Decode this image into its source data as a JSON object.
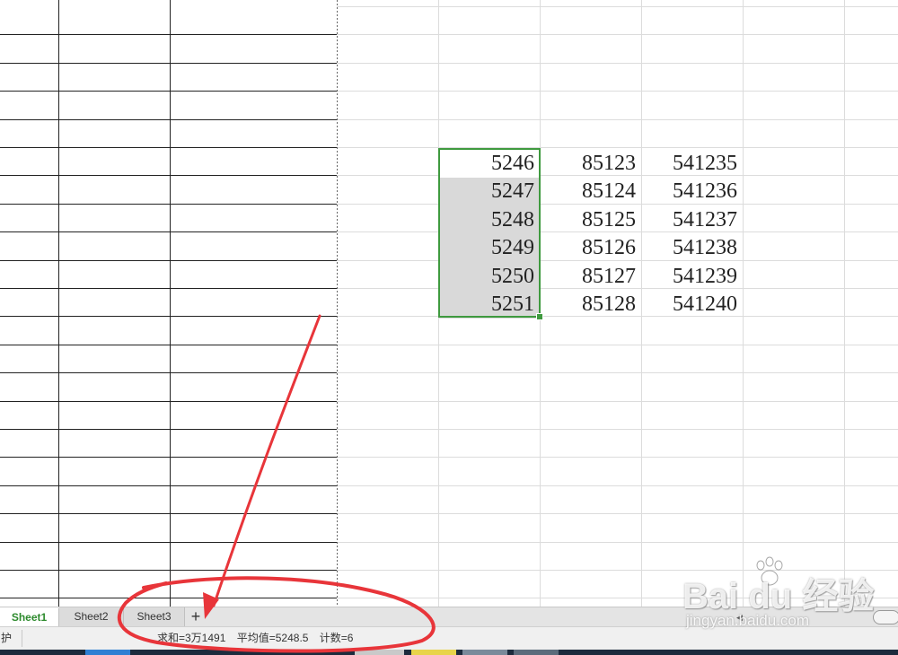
{
  "sheet": {
    "rows": [
      [
        "5246",
        "85123",
        "541235"
      ],
      [
        "5247",
        "85124",
        "541236"
      ],
      [
        "5248",
        "85125",
        "541237"
      ],
      [
        "5249",
        "85126",
        "541238"
      ],
      [
        "5250",
        "85127",
        "541239"
      ],
      [
        "5251",
        "85128",
        "541240"
      ]
    ],
    "selected_rows": 6
  },
  "tabs": [
    {
      "label": "Sheet1",
      "active": true
    },
    {
      "label": "Sheet2",
      "active": false
    },
    {
      "label": "Sheet3",
      "active": false
    }
  ],
  "add_sheet_label": "+",
  "status": {
    "left_text": "护",
    "sum": "求和=3万1491",
    "average": "平均值=5248.5",
    "count": "计数=6"
  },
  "watermark": {
    "logo": "Bai du 经验",
    "subtitle": "jingyan.baidu.com"
  },
  "colors": {
    "selection_border": "#3f9a3f",
    "selection_fill": "#d9d9d9",
    "active_tab_text": "#2e8b2e",
    "annotation": "#e8353a"
  },
  "icons": {
    "add_sheet": "plus-icon",
    "scroll_left": "triangle-left-icon",
    "watermark_paw": "paw-icon"
  }
}
